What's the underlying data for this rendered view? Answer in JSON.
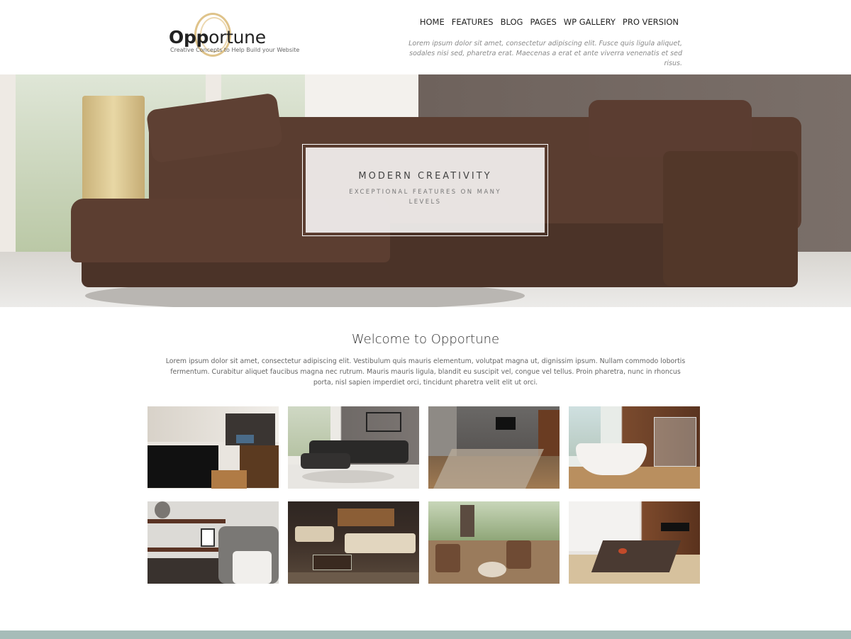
{
  "site": {
    "logo_title_bold": "Opp",
    "logo_title_rest": "ortune",
    "logo_tagline": "Creative Concepts to Help Build your Website",
    "header_blurb": "Lorem ipsum dolor sit amet, consectetur adipiscing elit. Fusce quis ligula aliquet, sodales nisi sed, pharetra erat. Maecenas a erat et ante viverra venenatis et sed risus."
  },
  "nav": {
    "items": [
      "HOME",
      "FEATURES",
      "BLOG",
      "PAGES",
      "WP GALLERY",
      "PRO VERSION"
    ]
  },
  "hero": {
    "title": "MODERN CREATIVITY",
    "subtitle": "EXCEPTIONAL FEATURES ON MANY LEVELS"
  },
  "welcome": {
    "title": "Welcome to Opportune",
    "text": "Lorem ipsum dolor sit amet, consectetur adipiscing elit. Vestibulum quis mauris elementum, volutpat magna ut, dignissim ipsum. Nullam commodo lobortis fermentum. Curabitur aliquet faucibus magna nec rutrum. Mauris mauris ligula, blandit eu suscipit vel, congue vel tellus. Proin pharetra, nunc in rhoncus porta, nisl sapien imperdiet orci, tincidunt pharetra velit elit ut orci."
  },
  "gallery": {
    "items": [
      {
        "name": "kitchen-island"
      },
      {
        "name": "black-sectional-sofa"
      },
      {
        "name": "living-room-tv"
      },
      {
        "name": "bathroom-bathtub"
      },
      {
        "name": "shelving-armchair"
      },
      {
        "name": "lounge-sofas"
      },
      {
        "name": "patio-chairs"
      },
      {
        "name": "modern-kitchen"
      }
    ]
  },
  "colors": {
    "footer_bar": "#a6bcb8",
    "logo_ring": "#d9b976"
  }
}
